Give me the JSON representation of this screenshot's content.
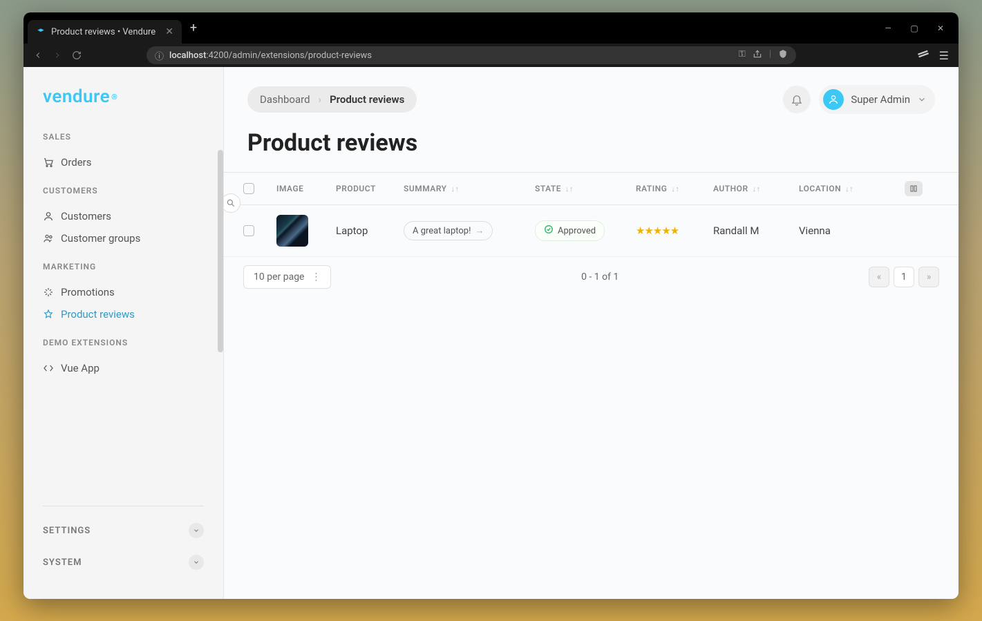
{
  "browser": {
    "tab_title": "Product reviews • Vendure",
    "url_host": "localhost",
    "url_path": ":4200/admin/extensions/product-reviews"
  },
  "brand": "vendure",
  "sidebar": {
    "sections": [
      {
        "heading": "SALES",
        "items": [
          {
            "label": "Orders",
            "icon": "cart"
          }
        ]
      },
      {
        "heading": "CUSTOMERS",
        "items": [
          {
            "label": "Customers",
            "icon": "user"
          },
          {
            "label": "Customer groups",
            "icon": "users"
          }
        ]
      },
      {
        "heading": "MARKETING",
        "items": [
          {
            "label": "Promotions",
            "icon": "sparkle"
          },
          {
            "label": "Product reviews",
            "icon": "star",
            "active": true
          }
        ]
      },
      {
        "heading": "DEMO EXTENSIONS",
        "items": [
          {
            "label": "Vue App",
            "icon": "code"
          }
        ]
      }
    ],
    "settings_label": "SETTINGS",
    "system_label": "SYSTEM"
  },
  "breadcrumb": {
    "root": "Dashboard",
    "current": "Product reviews"
  },
  "user": {
    "name": "Super Admin"
  },
  "page": {
    "title": "Product reviews"
  },
  "columns": {
    "image": "IMAGE",
    "product": "PRODUCT",
    "summary": "SUMMARY",
    "state": "STATE",
    "rating": "RATING",
    "author": "AUTHOR",
    "location": "LOCATION"
  },
  "rows": [
    {
      "product": "Laptop",
      "summary": "A great laptop!",
      "state": "Approved",
      "rating": 5,
      "author": "Randall M",
      "location": "Vienna"
    }
  ],
  "footer": {
    "per_page": "10 per page",
    "range": "0 - 1 of 1",
    "page_current": "1",
    "prev": "«",
    "next": "»"
  }
}
